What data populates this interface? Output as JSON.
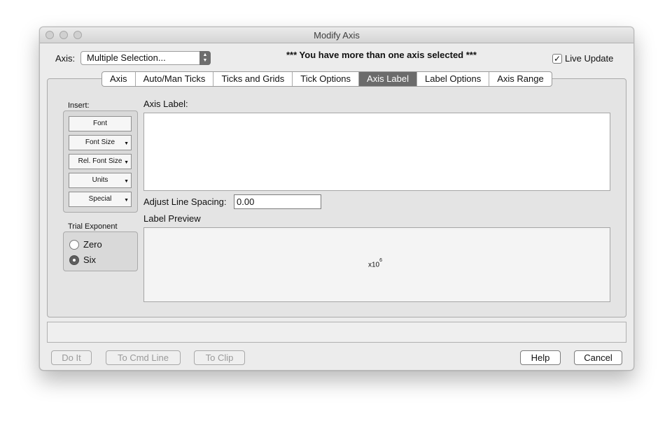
{
  "window": {
    "title": "Modify Axis"
  },
  "header": {
    "axis_label": "Axis:",
    "axis_select": "Multiple Selection...",
    "warning": "*** You have more than one axis selected ***",
    "live_update_label": "Live Update",
    "live_update_checked": "✓"
  },
  "tabs": [
    {
      "label": "Axis"
    },
    {
      "label": "Auto/Man Ticks"
    },
    {
      "label": "Ticks and Grids"
    },
    {
      "label": "Tick Options"
    },
    {
      "label": "Axis Label",
      "active": true
    },
    {
      "label": "Label Options"
    },
    {
      "label": "Axis Range"
    }
  ],
  "insert": {
    "title": "Insert:",
    "buttons": [
      {
        "label": "Font",
        "has_menu": false
      },
      {
        "label": "Font Size",
        "has_menu": true
      },
      {
        "label": "Rel. Font Size",
        "has_menu": true
      },
      {
        "label": "Units",
        "has_menu": true
      },
      {
        "label": "Special",
        "has_menu": true
      }
    ]
  },
  "trial_exponent": {
    "title": "Trial Exponent",
    "options": [
      {
        "label": "Zero",
        "selected": false
      },
      {
        "label": "Six",
        "selected": true
      }
    ]
  },
  "axis_label_section": {
    "title": "Axis Label:",
    "value": ""
  },
  "line_spacing": {
    "label": "Adjust Line Spacing:",
    "value": "0.00"
  },
  "preview": {
    "title": "Label Preview",
    "base": "x10",
    "exponent": "6"
  },
  "footer": {
    "do_it": "Do It",
    "to_cmd_line": "To Cmd Line",
    "to_clip": "To Clip",
    "help": "Help",
    "cancel": "Cancel"
  }
}
